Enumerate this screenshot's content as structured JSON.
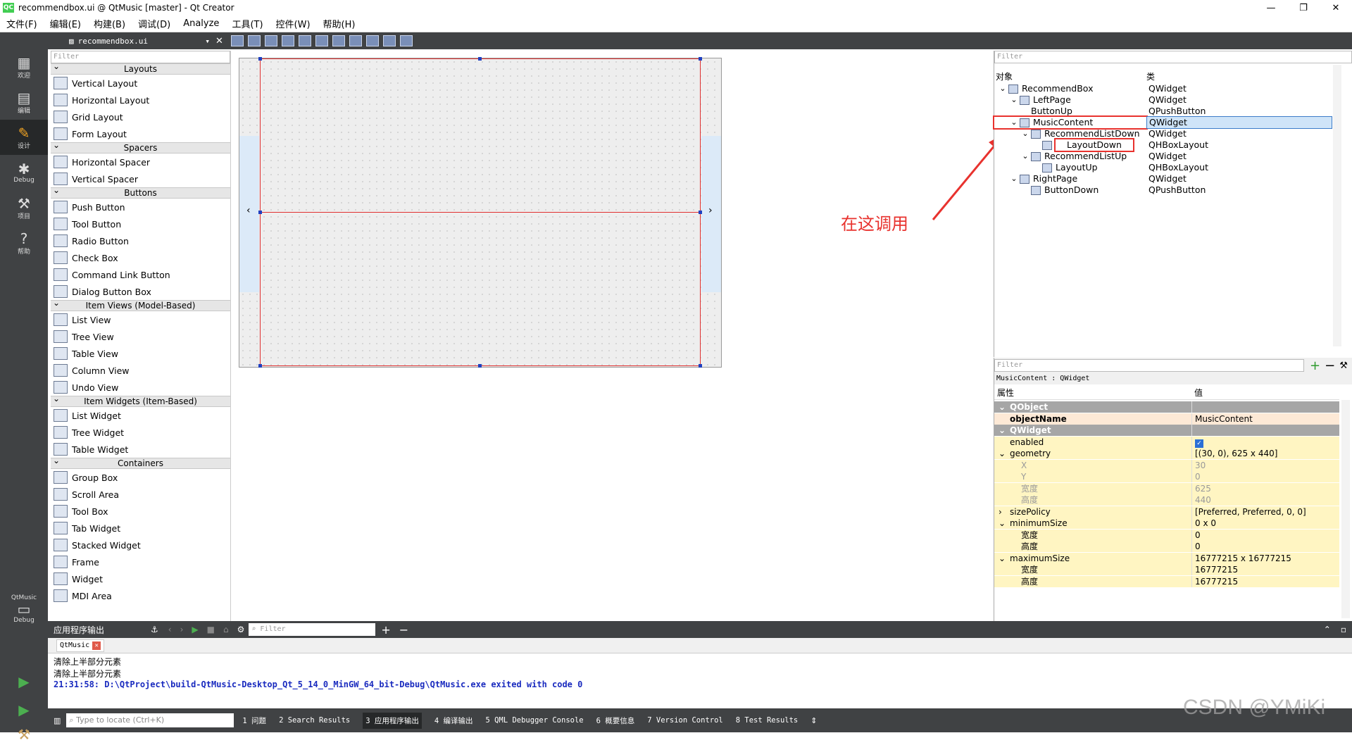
{
  "window": {
    "app_icon": "QC",
    "title": "recommendbox.ui @ QtMusic [master] - Qt Creator",
    "minimize_glyph": "—",
    "maximize_glyph": "❐",
    "close_glyph": "✕"
  },
  "menu": [
    "文件(F)",
    "编辑(E)",
    "构建(B)",
    "调试(D)",
    "Analyze",
    "工具(T)",
    "控件(W)",
    "帮助(H)"
  ],
  "modes": [
    {
      "label": "欢迎",
      "icon": "grid-icon",
      "glyph": "▦"
    },
    {
      "label": "编辑",
      "icon": "edit-doc-icon",
      "glyph": "▤"
    },
    {
      "label": "设计",
      "icon": "pencil-icon",
      "glyph": "✎"
    },
    {
      "label": "Debug",
      "icon": "bug-icon",
      "glyph": "✱"
    },
    {
      "label": "项目",
      "icon": "wrench-icon",
      "glyph": "⚒"
    },
    {
      "label": "帮助",
      "icon": "help-icon",
      "glyph": "?"
    }
  ],
  "kit": {
    "project": "QtMusic",
    "mode": "Debug"
  },
  "editor": {
    "file_name": "recommendbox.ui"
  },
  "widgetbox": {
    "filter_placeholder": "Filter",
    "categories": [
      {
        "name": "Layouts",
        "items": [
          "Vertical Layout",
          "Horizontal Layout",
          "Grid Layout",
          "Form Layout"
        ]
      },
      {
        "name": "Spacers",
        "items": [
          "Horizontal Spacer",
          "Vertical Spacer"
        ]
      },
      {
        "name": "Buttons",
        "items": [
          "Push Button",
          "Tool Button",
          "Radio Button",
          "Check Box",
          "Command Link Button",
          "Dialog Button Box"
        ]
      },
      {
        "name": "Item Views (Model-Based)",
        "items": [
          "List View",
          "Tree View",
          "Table View",
          "Column View",
          "Undo View"
        ]
      },
      {
        "name": "Item Widgets (Item-Based)",
        "items": [
          "List Widget",
          "Tree Widget",
          "Table Widget"
        ]
      },
      {
        "name": "Containers",
        "items": [
          "Group Box",
          "Scroll Area",
          "Tool Box",
          "Tab Widget",
          "Stacked Widget",
          "Frame",
          "Widget",
          "MDI Area"
        ]
      }
    ]
  },
  "annotation": {
    "text": "在这调用",
    "color": "#e8322e"
  },
  "object_inspector": {
    "filter_placeholder": "Filter",
    "col_object": "对象",
    "col_class": "类",
    "rows": [
      {
        "name": "RecommendBox",
        "cls": "QWidget"
      },
      {
        "name": "LeftPage",
        "cls": "QWidget"
      },
      {
        "name": "ButtonUp",
        "cls": "QPushButton"
      },
      {
        "name": "MusicContent",
        "cls": "QWidget"
      },
      {
        "name": "RecommendListDown",
        "cls": "QWidget"
      },
      {
        "name": "LayoutDown",
        "cls": "QHBoxLayout"
      },
      {
        "name": "RecommendListUp",
        "cls": "QWidget"
      },
      {
        "name": "LayoutUp",
        "cls": "QHBoxLayout"
      },
      {
        "name": "RightPage",
        "cls": "QWidget"
      },
      {
        "name": "ButtonDown",
        "cls": "QPushButton"
      }
    ]
  },
  "property_editor": {
    "filter_placeholder": "Filter",
    "context": "MusicContent : QWidget",
    "col_property": "属性",
    "col_value": "值",
    "rows": [
      {
        "name": "QObject",
        "value": ""
      },
      {
        "name": "objectName",
        "value": "MusicContent"
      },
      {
        "name": "QWidget",
        "value": ""
      },
      {
        "name": "enabled",
        "value": "✓"
      },
      {
        "name": "geometry",
        "value": "[(30, 0), 625 x 440]"
      },
      {
        "name": "X",
        "value": "30"
      },
      {
        "name": "Y",
        "value": "0"
      },
      {
        "name": "宽度",
        "value": "625"
      },
      {
        "name": "高度",
        "value": "440"
      },
      {
        "name": "sizePolicy",
        "value": "[Preferred, Preferred, 0, 0]"
      },
      {
        "name": "minimumSize",
        "value": "0 x 0"
      },
      {
        "name": "宽度",
        "value": "0"
      },
      {
        "name": "高度",
        "value": "0"
      },
      {
        "name": "maximumSize",
        "value": "16777215 x 16777215"
      },
      {
        "name": "宽度",
        "value": "16777215"
      },
      {
        "name": "高度",
        "value": "16777215"
      }
    ]
  },
  "output": {
    "title": "应用程序输出",
    "filter_placeholder": "Filter",
    "tab": "QtMusic",
    "lines": [
      "清除上半部分元素",
      "清除上半部分元素",
      "21:31:58: D:\\QtProject\\build-QtMusic-Desktop_Qt_5_14_0_MinGW_64_bit-Debug\\QtMusic.exe exited with code 0"
    ]
  },
  "statusbar": {
    "locate_placeholder": "Type to locate (Ctrl+K)",
    "tabs": [
      "1 问题",
      "2 Search Results",
      "3 应用程序输出",
      "4 编译输出",
      "5 QML Debugger Console",
      "6 概要信息",
      "7 Version Control",
      "8 Test Results"
    ]
  },
  "watermark": "CSDN @YMiKi"
}
